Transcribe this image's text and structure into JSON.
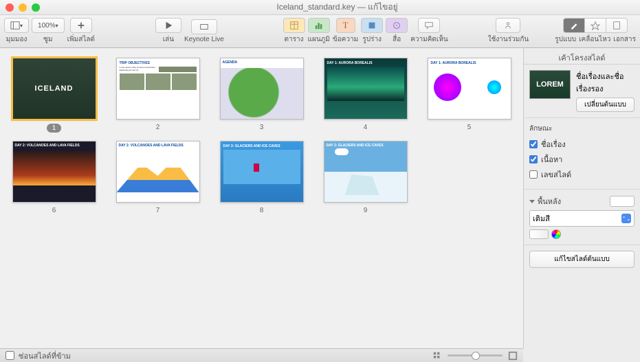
{
  "window": {
    "title": "Iceland_standard.key — แก้ไขอยู่"
  },
  "toolbar": {
    "view": "มุมมอง",
    "zoom": "ซูม",
    "zoom_value": "100%",
    "add_slide": "เพิ่มสไลด์",
    "play": "เล่น",
    "keynote_live": "Keynote Live",
    "table": "ตาราง",
    "chart": "แผนภูมิ",
    "text": "ข้อความ",
    "shape": "รูปร่าง",
    "media": "สื่อ",
    "comment": "ความคิดเห็น",
    "collaborate": "ใช้งานร่วมกัน",
    "format": "รูปแบบ",
    "animate": "เคลื่อนไหว",
    "document": "เอกสาร"
  },
  "slides": [
    {
      "num": "1",
      "title": "ICELAND"
    },
    {
      "num": "2",
      "title": "TRIP OBJECTIVES"
    },
    {
      "num": "3",
      "title": "AGENDA"
    },
    {
      "num": "4",
      "title": "DAY 1: AURORA BOREALIS"
    },
    {
      "num": "5",
      "title": "DAY 1: AURORA BOREALIS"
    },
    {
      "num": "6",
      "title": "DAY 2: VOLCANOES AND LAVA FIELDS"
    },
    {
      "num": "7",
      "title": "DAY 2: VOLCANOES AND LAVA FIELDS"
    },
    {
      "num": "8",
      "title": "DAY 3: GLACIERS AND ICE CAVES"
    },
    {
      "num": "9",
      "title": "DAY 3: GLACIERS AND ICE CAVES"
    }
  ],
  "sidebar": {
    "tab": "เค้าโครงสไลด์",
    "preview_text": "LOREM",
    "title_subtitle": "ชื่อเรื่องและชื่อเรื่องรอง",
    "change_master": "เปลี่ยนต้นแบบ",
    "appearance": "ลักษณะ",
    "chk_title": "ชื่อเรื่อง",
    "chk_body": "เนื้อหา",
    "chk_slidenum": "เลขสไลด์",
    "background": "พื้นหลัง",
    "fill": "เติมสี",
    "edit_master_btn": "แก้ไขสไลด์ต้นแบบ"
  },
  "footer": {
    "hide_skipped": "ซ่อนสไลด์ที่ข้าม"
  }
}
